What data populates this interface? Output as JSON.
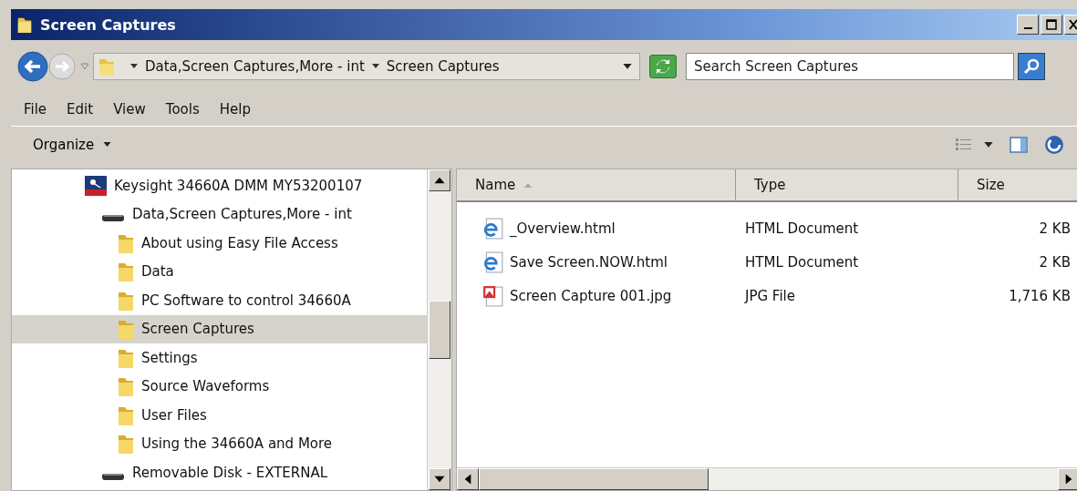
{
  "window": {
    "title": "Screen Captures"
  },
  "address": {
    "segments": [
      "Data,Screen Captures,More - int",
      "Screen Captures"
    ]
  },
  "search": {
    "placeholder": "Search Screen Captures"
  },
  "menu": [
    "File",
    "Edit",
    "View",
    "Tools",
    "Help"
  ],
  "toolbar": {
    "organize": "Organize"
  },
  "tree": [
    {
      "label": "Keysight 34660A DMM MY53200107",
      "kind": "device",
      "selected": false,
      "children": [
        {
          "label": "Data,Screen Captures,More - int",
          "kind": "drive",
          "selected": false,
          "children": [
            {
              "label": "About using Easy File Access",
              "kind": "folder",
              "selected": false
            },
            {
              "label": "Data",
              "kind": "folder",
              "selected": false
            },
            {
              "label": "PC Software to control 34660A",
              "kind": "folder",
              "selected": false
            },
            {
              "label": "Screen Captures",
              "kind": "folder",
              "selected": true
            },
            {
              "label": "Settings",
              "kind": "folder",
              "selected": false
            },
            {
              "label": "Source Waveforms",
              "kind": "folder",
              "selected": false
            },
            {
              "label": "User Files",
              "kind": "folder",
              "selected": false
            },
            {
              "label": "Using the 34660A and More",
              "kind": "folder",
              "selected": false
            }
          ]
        },
        {
          "label": "Removable Disk - EXTERNAL",
          "kind": "drive",
          "selected": false
        }
      ]
    }
  ],
  "table": {
    "columns": [
      "Name",
      "Type",
      "Size"
    ],
    "rows": [
      {
        "name": "_Overview.html",
        "kind": "html",
        "type": "HTML Document",
        "size": "2 KB"
      },
      {
        "name": "Save Screen.NOW.html",
        "kind": "html",
        "type": "HTML Document",
        "size": "2 KB"
      },
      {
        "name": "Screen Capture 001.jpg",
        "kind": "jpg",
        "type": "JPG File",
        "size": "1,716 KB"
      }
    ]
  }
}
